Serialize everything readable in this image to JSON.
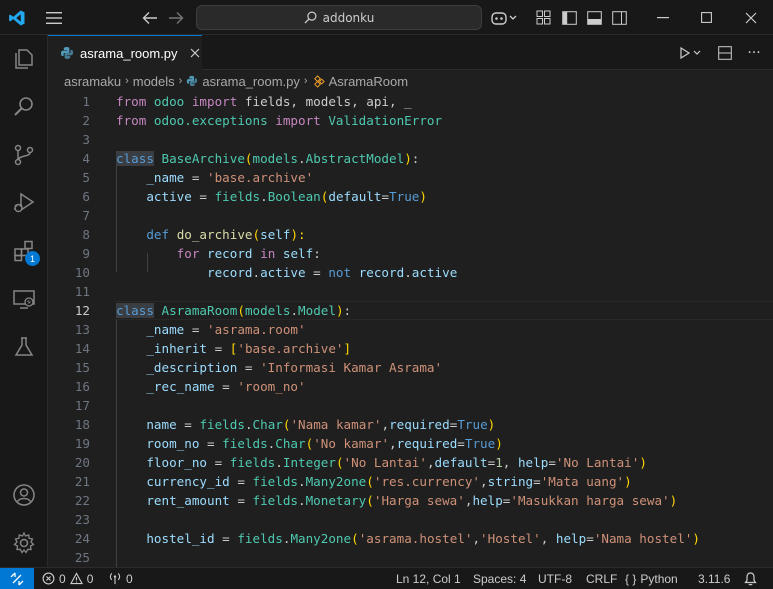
{
  "titlebar": {
    "search_text": "addonku",
    "colors": {
      "accent": "#0078d4",
      "logo": "#23a9f2"
    }
  },
  "activity_bar": {
    "items": [
      {
        "icon": "explorer-icon"
      },
      {
        "icon": "search-icon"
      },
      {
        "icon": "source-control-icon"
      },
      {
        "icon": "run-debug-icon"
      },
      {
        "icon": "extensions-icon",
        "badge": "1"
      },
      {
        "icon": "remote-explorer-icon"
      },
      {
        "icon": "testing-icon"
      }
    ],
    "bottom": [
      {
        "icon": "accounts-icon"
      },
      {
        "icon": "manage-gear-icon"
      }
    ]
  },
  "tab": {
    "label": "asrama_room.py",
    "icon": "python-file-icon"
  },
  "breadcrumb": {
    "p1": "asramaku",
    "p2": "models",
    "p3": "asrama_room.py",
    "p4": "AsramaRoom"
  },
  "editor": {
    "current_line": 12,
    "lines": [
      "1",
      "2",
      "3",
      "4",
      "5",
      "6",
      "7",
      "8",
      "9",
      "10",
      "11",
      "12",
      "13",
      "14",
      "15",
      "16",
      "17",
      "18",
      "19",
      "20",
      "21",
      "22",
      "23",
      "24",
      "25"
    ]
  },
  "code": {
    "l1": {
      "a": "from",
      "b": " odoo ",
      "c": "import",
      "d": " fields, models, api, _"
    },
    "l2": {
      "a": "from",
      "b": " odoo.exceptions ",
      "c": "import",
      "d": " ValidationError"
    },
    "l4": {
      "a": "class",
      "b": " ",
      "c": "BaseArchive",
      "d": "(",
      "e": "models",
      "f": ".",
      "g": "AbstractModel",
      "h": ")",
      "i": ":"
    },
    "l5": {
      "a": "    ",
      "b": "_name",
      "c": " = ",
      "d": "'base.archive'"
    },
    "l6": {
      "a": "    ",
      "b": "active",
      "c": " = ",
      "d": "fields",
      "e": ".",
      "f": "Boolean",
      "g": "(",
      "h": "default",
      "i": "=",
      "j": "True",
      "k": ")"
    },
    "l8": {
      "a": "    ",
      "b": "def",
      "c": " ",
      "d": "do_archive",
      "e": "(",
      "f": "self",
      "g": "):"
    },
    "l9": {
      "a": "        ",
      "b": "for",
      "c": " ",
      "d": "record",
      "e": " ",
      "f": "in",
      "g": " ",
      "h": "self",
      "i": ":"
    },
    "l10": {
      "a": "            ",
      "b": "record",
      "c": ".",
      "d": "active",
      "e": " = ",
      "f": "not",
      "g": " ",
      "h": "record",
      "i": ".",
      "j": "active"
    },
    "l12": {
      "a": "class",
      "b": " ",
      "c": "AsramaRoom",
      "d": "(",
      "e": "models",
      "f": ".",
      "g": "Model",
      "h": ")",
      "i": ":"
    },
    "l13": {
      "a": "    ",
      "b": "_name",
      "c": " = ",
      "d": "'asrama.room'"
    },
    "l14": {
      "a": "    ",
      "b": "_inherit",
      "c": " = ",
      "d": "[",
      "e": "'base.archive'",
      "f": "]"
    },
    "l15": {
      "a": "    ",
      "b": "_description",
      "c": " = ",
      "d": "'Informasi Kamar Asrama'"
    },
    "l16": {
      "a": "    ",
      "b": "_rec_name",
      "c": " = ",
      "d": "'room_no'"
    },
    "l18": {
      "a": "    ",
      "b": "name",
      "c": " = ",
      "d": "fields",
      "e": ".",
      "f": "Char",
      "g": "(",
      "h": "'Nama kamar'",
      "i": ",",
      "j": "required",
      "k": "=",
      "l": "True",
      "m": ")"
    },
    "l19": {
      "a": "    ",
      "b": "room_no",
      "c": " = ",
      "d": "fields",
      "e": ".",
      "f": "Char",
      "g": "(",
      "h": "'No kamar'",
      "i": ",",
      "j": "required",
      "k": "=",
      "l": "True",
      "m": ")"
    },
    "l20": {
      "a": "    ",
      "b": "floor_no",
      "c": " = ",
      "d": "fields",
      "e": ".",
      "f": "Integer",
      "g": "(",
      "h": "'No Lantai'",
      "i": ",",
      "j": "default",
      "k": "=",
      "l": "1",
      "m": ", ",
      "n": "help",
      "o": "=",
      "p": "'No Lantai'",
      "q": ")"
    },
    "l21": {
      "a": "    ",
      "b": "currency_id",
      "c": " = ",
      "d": "fields",
      "e": ".",
      "f": "Many2one",
      "g": "(",
      "h": "'res.currency'",
      "i": ",",
      "j": "string",
      "k": "=",
      "l": "'Mata uang'",
      "m": ")"
    },
    "l22": {
      "a": "    ",
      "b": "rent_amount",
      "c": " = ",
      "d": "fields",
      "e": ".",
      "f": "Monetary",
      "g": "(",
      "h": "'Harga sewa'",
      "i": ",",
      "j": "help",
      "k": "=",
      "l": "'Masukkan harga sewa'",
      "m": ")"
    },
    "l24": {
      "a": "    ",
      "b": "hostel_id",
      "c": " = ",
      "d": "fields",
      "e": ".",
      "f": "Many2one",
      "g": "(",
      "h": "'asrama.hostel'",
      "i": ",",
      "j": "'Hostel'",
      "k": ", ",
      "l": "help",
      "m": "=",
      "n": "'Nama hostel'",
      "o": ")"
    }
  },
  "status": {
    "errors": "0",
    "warnings": "0",
    "ports": "0",
    "position": "Ln 12, Col 1",
    "spaces": "Spaces: 4",
    "encoding": "UTF-8",
    "eol": "CRLF",
    "language": "Python",
    "language_prefix": "{ }",
    "version": "3.11.6"
  }
}
